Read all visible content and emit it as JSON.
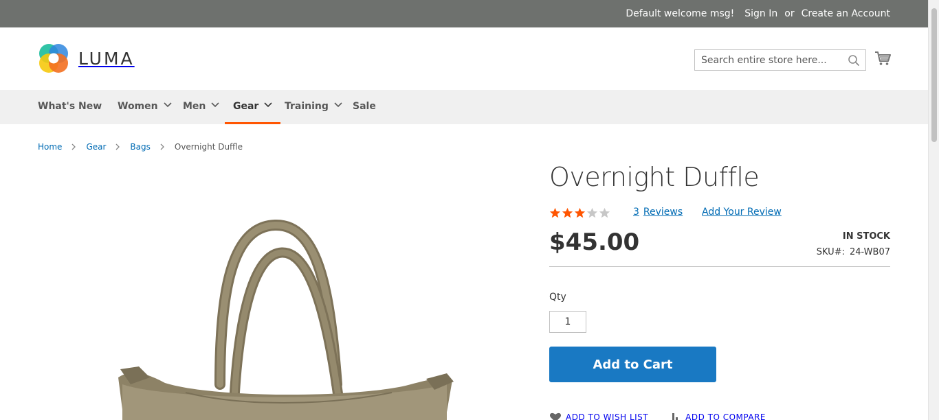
{
  "header": {
    "welcome": "Default welcome msg!",
    "sign_in": "Sign In",
    "or": "or",
    "create_account": "Create an Account"
  },
  "logo": {
    "text": "LUMA"
  },
  "search": {
    "placeholder": "Search entire store here..."
  },
  "nav": {
    "items": [
      {
        "label": "What's New",
        "dropdown": false
      },
      {
        "label": "Women",
        "dropdown": true
      },
      {
        "label": "Men",
        "dropdown": true
      },
      {
        "label": "Gear",
        "dropdown": true,
        "active": true
      },
      {
        "label": "Training",
        "dropdown": true
      },
      {
        "label": "Sale",
        "dropdown": false
      }
    ]
  },
  "breadcrumbs": [
    "Home",
    "Gear",
    "Bags",
    "Overnight Duffle"
  ],
  "product": {
    "title": "Overnight Duffle",
    "rating_stars": 3,
    "rating_max": 5,
    "review_count": "3",
    "reviews_label": "Reviews",
    "add_review": "Add Your Review",
    "price": "$45.00",
    "stock": "IN STOCK",
    "sku_label": "SKU#:",
    "sku": "24-WB07",
    "qty_label": "Qty",
    "qty": "1",
    "add_to_cart": "Add to Cart",
    "wishlist": "ADD TO WISH LIST",
    "compare": "ADD TO COMPARE"
  },
  "colors": {
    "accent": "#ff5501",
    "link": "#006bb4",
    "button": "#1979c3",
    "star_filled": "#ff5501",
    "star_empty": "#c7c7c7"
  }
}
